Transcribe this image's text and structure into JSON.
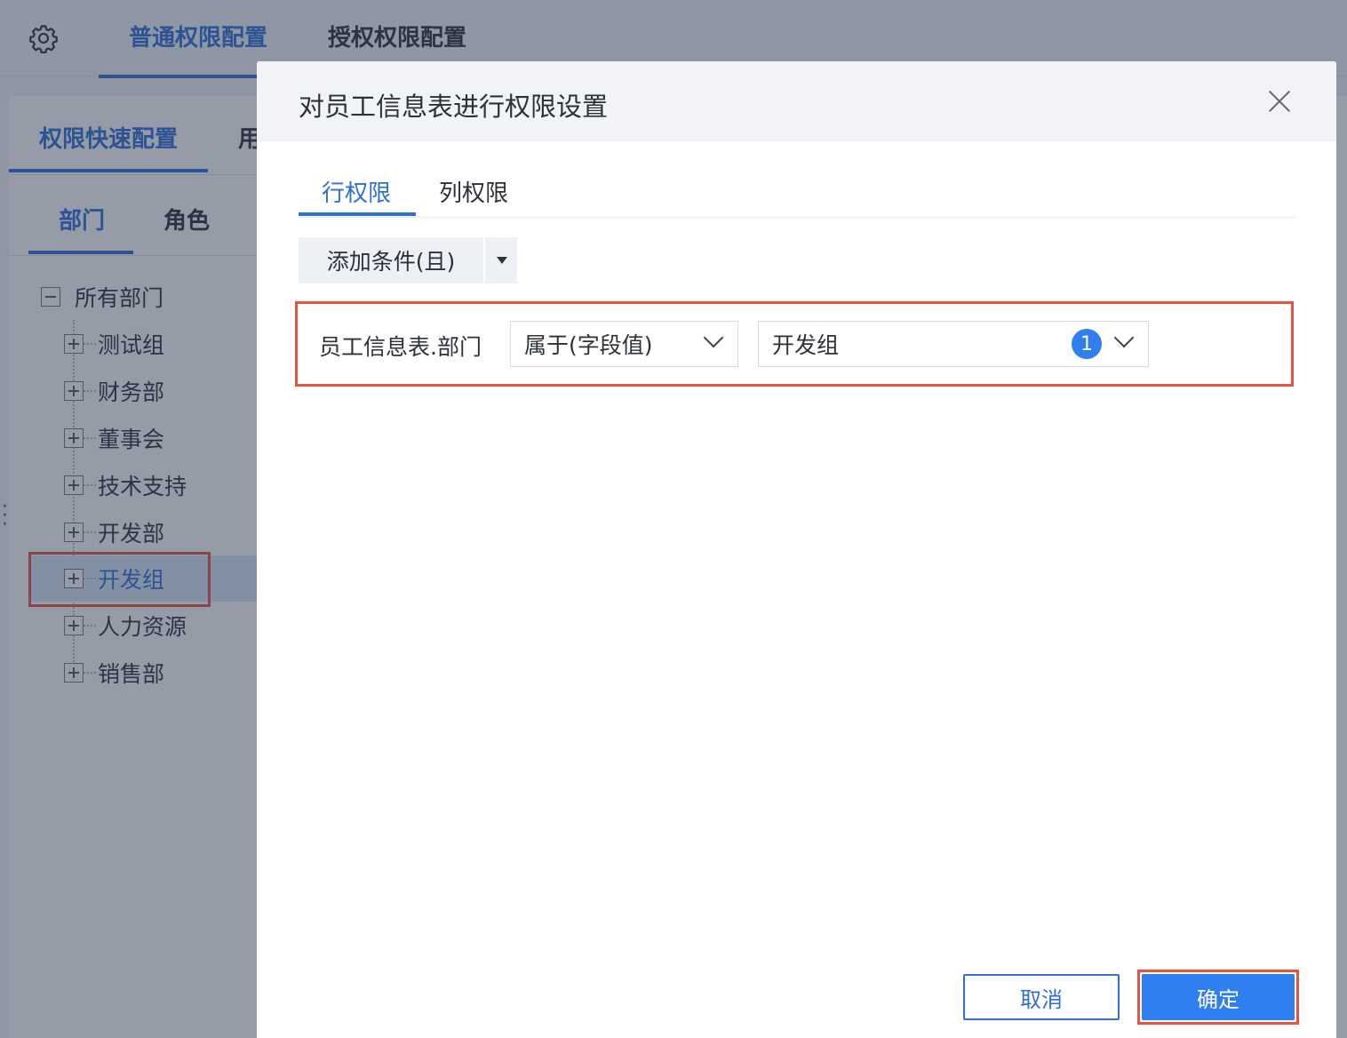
{
  "top_tabs": [
    {
      "label": "普通权限配置",
      "active": true
    },
    {
      "label": "授权权限配置",
      "active": false
    }
  ],
  "sub_tabs": [
    {
      "label": "权限快速配置",
      "active": true
    },
    {
      "label": "用"
    }
  ],
  "dept_tabs": [
    {
      "label": "部门",
      "active": true
    },
    {
      "label": "角色",
      "active": false
    }
  ],
  "tree": {
    "root": "所有部门",
    "items": [
      "测试组",
      "财务部",
      "董事会",
      "技术支持",
      "开发部",
      "开发组",
      "人力资源",
      "销售部"
    ],
    "selected": "开发组"
  },
  "modal": {
    "title": "对员工信息表进行权限设置",
    "tabs": [
      {
        "label": "行权限",
        "active": true
      },
      {
        "label": "列权限",
        "active": false
      }
    ],
    "add_condition_label": "添加条件(且)",
    "condition": {
      "field": "员工信息表.部门",
      "operator": "属于(字段值)",
      "value": "开发组",
      "value_count": "1"
    },
    "cancel_label": "取消",
    "confirm_label": "确定"
  },
  "colors": {
    "accent": "#2f6fd8",
    "primary_button": "#2f7ff0",
    "highlight": "#e8533f"
  }
}
